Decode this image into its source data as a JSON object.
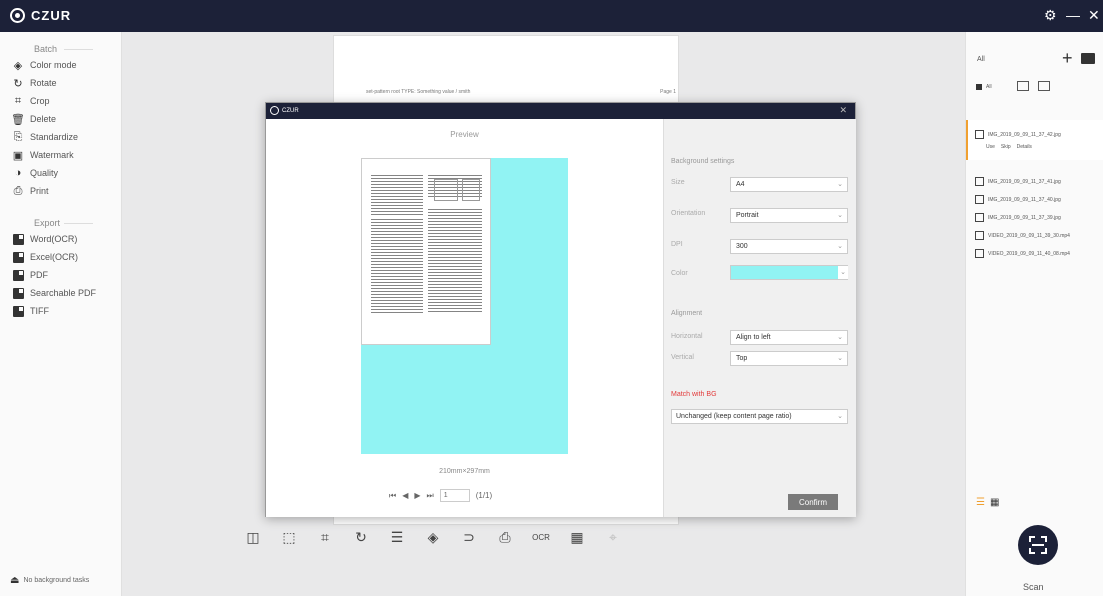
{
  "app": {
    "title": "CZUR",
    "window_controls": [
      "⚙",
      "—",
      "✕"
    ]
  },
  "sidebar": {
    "batch_title": "Batch",
    "batch_items": [
      {
        "label": "Color mode",
        "icon": "color-mode-icon"
      },
      {
        "label": "Rotate",
        "icon": "rotate-icon"
      },
      {
        "label": "Crop",
        "icon": "crop-icon"
      },
      {
        "label": "Delete",
        "icon": "delete-icon"
      },
      {
        "label": "Standardize",
        "icon": "standardize-icon"
      },
      {
        "label": "Watermark",
        "icon": "watermark-icon"
      },
      {
        "label": "Quality",
        "icon": "quality-icon"
      },
      {
        "label": "Print",
        "icon": "print-icon"
      }
    ],
    "export_title": "Export",
    "export_items": [
      {
        "label": "Word(OCR)",
        "icon": "word-icon"
      },
      {
        "label": "Excel(OCR)",
        "icon": "excel-icon"
      },
      {
        "label": "PDF",
        "icon": "pdf-icon"
      },
      {
        "label": "Searchable PDF",
        "icon": "searchable-pdf-icon"
      },
      {
        "label": "TIFF",
        "icon": "tiff-icon"
      }
    ],
    "no_background_label": "No background tasks"
  },
  "right_panel": {
    "header_label": "All",
    "filter_all_label": "All",
    "selected_file": {
      "name": "IMG_2019_09_09_11_37_42.jpg",
      "actions": [
        "Use",
        "Skip",
        "Details"
      ]
    },
    "files": [
      "IMG_2019_09_09_11_37_41.jpg",
      "IMG_2019_09_09_11_37_40.jpg",
      "IMG_2019_09_09_11_37_39.jpg",
      "VIDEO_2019_09_09_11_39_30.mp4",
      "VIDEO_2019_09_09_11_40_08.mp4"
    ],
    "scan_label": "Scan"
  },
  "background_doc": {
    "left_text": "set-pattern root TYPE: Something value / smith",
    "right_text": "Page 1"
  },
  "modal": {
    "title": "CZUR",
    "preview_title": "Preview",
    "dimensions": "210mm×297mm",
    "page_input": "1",
    "page_total": "(1/1)",
    "settings": {
      "background_head": "Background settings",
      "size_label": "Size",
      "size_value": "A4",
      "orientation_label": "Orientation",
      "orientation_value": "Portrait",
      "dpi_label": "DPI",
      "dpi_value": "300",
      "color_label": "Color",
      "color_value": "#91f3f3",
      "alignment_head": "Alignment",
      "horizontal_label": "Horizontal",
      "horizontal_value": "Align to left",
      "vertical_label": "Vertical",
      "vertical_value": "Top",
      "match_label": "Match with BG",
      "match_value": "Unchanged (keep content page ratio)",
      "confirm_label": "Confirm"
    }
  },
  "colors": {
    "titlebar": "#1c2138",
    "accent_selection": "#f0a030",
    "bg_fill": "#91f3f3",
    "match_label": "#e23b3b"
  }
}
